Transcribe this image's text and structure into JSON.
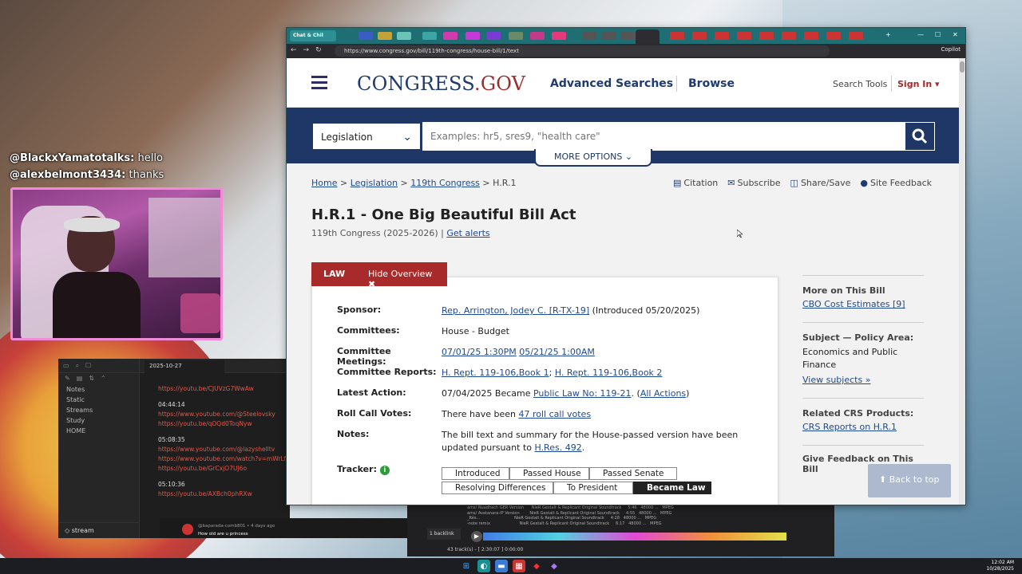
{
  "chat": {
    "line1_user": "@BlackxYamatotalks:",
    "line1_msg": " hello",
    "line2_user": "@alexbelmont3434:",
    "line2_msg": " thanks"
  },
  "notes": {
    "tab_title": "2025-10-27",
    "sidebar": [
      "Notes",
      "Static",
      "Streams",
      "Study",
      "HOME"
    ],
    "vault": "stream",
    "entries": [
      {
        "kind": "link",
        "text": "https://youtu.be/CJUVzG7WwAw"
      },
      {
        "kind": "ts",
        "text": "04:44:14"
      },
      {
        "kind": "link",
        "text": "https://www.youtube.com/@Steelovsky"
      },
      {
        "kind": "link",
        "text": "https://youtu.be/qOQd0ToqNyw"
      },
      {
        "kind": "ts",
        "text": "05:08:35"
      },
      {
        "kind": "link",
        "text": "https://www.youtube.com/@lazyshelltv"
      },
      {
        "kind": "link",
        "text": "https://www.youtube.com/watch?v=mWrLf8"
      },
      {
        "kind": "link",
        "text": "https://youtu.be/GrCxjO7UJ6o"
      },
      {
        "kind": "ts",
        "text": "05:10:36"
      },
      {
        "kind": "link",
        "text": "https://youtu.be/AXBch0phRXw"
      }
    ]
  },
  "comment": {
    "meta": "@baparada-comb801 • 4 days ago",
    "text": "How old are u princess"
  },
  "media": {
    "rows": [
      "ams/ Nuadhach GER Version      NieR Gestalt & Replicant Original Soundtrack     5:46   48000 ...   MPEG",
      "ams/ Avatanara-IP Version        NieR Gestalt & Replicant Original Soundtrack     4:55   48000 ...   MPEG",
      "_Rés...                           NieR Gestalt & Replicant Original Soundtrack     4:28   48000 ...   MPEG",
      "-note remix                       NieR Gestalt & Replicant Original Soundtrack     6:17   48000 ...   MPEG"
    ],
    "backlink": "1 backlink",
    "status": "43 track(s) - [ 2:30:07 ]   0:00:00"
  },
  "taskbar": {
    "time": "12:02 AM",
    "date": "10/28/2025"
  },
  "browser": {
    "chat_tab": "Chat & Chil",
    "url": "https://www.congress.gov/bill/119th-congress/house-bill/1/text",
    "copilot": "Copilot",
    "window_controls": [
      "—",
      "☐",
      "✕"
    ]
  },
  "site": {
    "logo_main": "CONGRESS",
    "logo_dot": ".GOV",
    "nav_advanced": "Advanced Searches",
    "nav_browse": "Browse",
    "search_tools": "Search Tools",
    "sign_in": "Sign In ▾",
    "search_scope": "Legislation",
    "search_placeholder": "Examples: hr5, sres9, \"health care\"",
    "more_options": "MORE OPTIONS ⌄",
    "breadcrumb": {
      "home": "Home",
      "legislation": "Legislation",
      "congress": "119th Congress",
      "current": "H.R.1"
    },
    "actions": {
      "citation": "Citation",
      "subscribe": "Subscribe",
      "share": "Share/Save",
      "feedback": "Site Feedback"
    },
    "bill_title": "H.R.1 - One Big Beautiful Bill Act",
    "bill_subtitle": "119th Congress (2025-2026) | ",
    "get_alerts": "Get alerts",
    "law_label": "LAW",
    "hide_overview": "Hide Overview ✖",
    "overview": {
      "sponsor_label": "Sponsor:",
      "sponsor_link": "Rep. Arrington, Jodey C. [R-TX-19]",
      "sponsor_rest": " (Introduced 05/20/2025)",
      "committees_label": "Committees:",
      "committees_value": "House - Budget",
      "meetings_label": "Committee Meetings:",
      "meeting1": "07/01/25 1:30PM",
      "meeting2": "05/21/25 1:00AM",
      "reports_label": "Committee Reports:",
      "report1": "H. Rept. 119-106,Book 1",
      "report_sep": "; ",
      "report2": "H. Rept. 119-106,Book 2",
      "latest_label": "Latest Action:",
      "latest_pre": "07/04/2025 Became ",
      "latest_link": "Public Law No: 119-21",
      "latest_mid": ".  (",
      "latest_all": "All Actions",
      "latest_post": ")",
      "rollcall_label": "Roll Call Votes:",
      "rollcall_pre": "There have been ",
      "rollcall_link": "47 roll call votes",
      "notes_label": "Notes:",
      "notes_pre": "The bill text and summary for the House-passed version have been updated pursuant to ",
      "notes_link": "H.Res. 492",
      "notes_post": ".",
      "tracker_label": "Tracker:"
    },
    "tracker_steps": [
      "Introduced",
      "Passed House",
      "Passed Senate",
      "Resolving Differences",
      "To President",
      "Became Law"
    ],
    "right": {
      "more_head": "More on This Bill",
      "cbo_link": "CBO Cost Estimates [9]",
      "subject_head": "Subject — Policy Area:",
      "subject_value": "Economics and Public Finance",
      "view_subjects": "View subjects »",
      "crs_head": "Related CRS Products:",
      "crs_link": "CRS Reports on H.R.1",
      "feedback_head": "Give Feedback on This Bill"
    },
    "back_to_top": "⬆ Back to top"
  }
}
